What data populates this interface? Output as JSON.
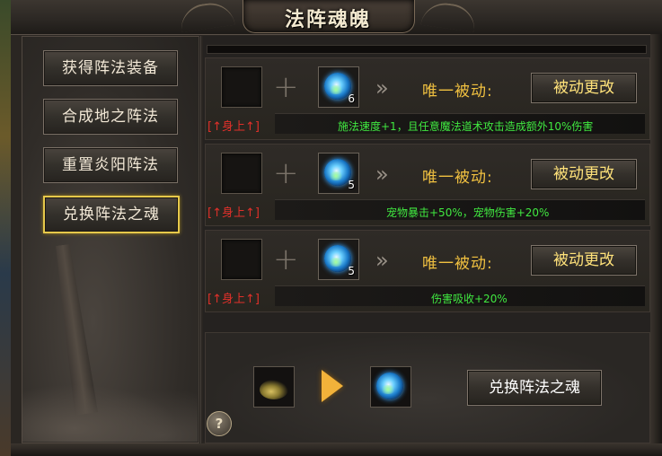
{
  "window": {
    "title": "法阵魂魄",
    "close_glyph": "✕"
  },
  "menu": {
    "items": [
      {
        "label": "获得阵法装备"
      },
      {
        "label": "合成地之阵法"
      },
      {
        "label": "重置炎阳阵法"
      },
      {
        "label": "兑换阵法之魂",
        "active": true
      }
    ]
  },
  "rows": [
    {
      "plus": "+",
      "item_count": "6",
      "arrow": "»",
      "passive_label": "唯一被动:",
      "change_button": "被动更改",
      "body_tag": "[↑身上↑]",
      "effect": "施法速度+1，且任意魔法道术攻击造成额外10%伤害"
    },
    {
      "plus": "+",
      "item_count": "5",
      "arrow": "»",
      "passive_label": "唯一被动:",
      "change_button": "被动更改",
      "body_tag": "[↑身上↑]",
      "effect": "宠物暴击+50%，宠物伤害+20%"
    },
    {
      "plus": "+",
      "item_count": "5",
      "arrow": "»",
      "passive_label": "唯一被动:",
      "change_button": "被动更改",
      "body_tag": "[↑身上↑]",
      "effect": "伤害吸收+20%"
    }
  ],
  "exchange": {
    "button": "兑换阵法之魂",
    "help": "?"
  },
  "colors": {
    "accent_gold": "#f0c040",
    "effect_green": "#40e840",
    "tag_red": "#e0302a",
    "active_border": "#e6c84a"
  },
  "icons": {
    "item": "blue-soul-orb-icon",
    "source": "golden-smoke-icon",
    "arrow": "gold-arrow-icon"
  }
}
